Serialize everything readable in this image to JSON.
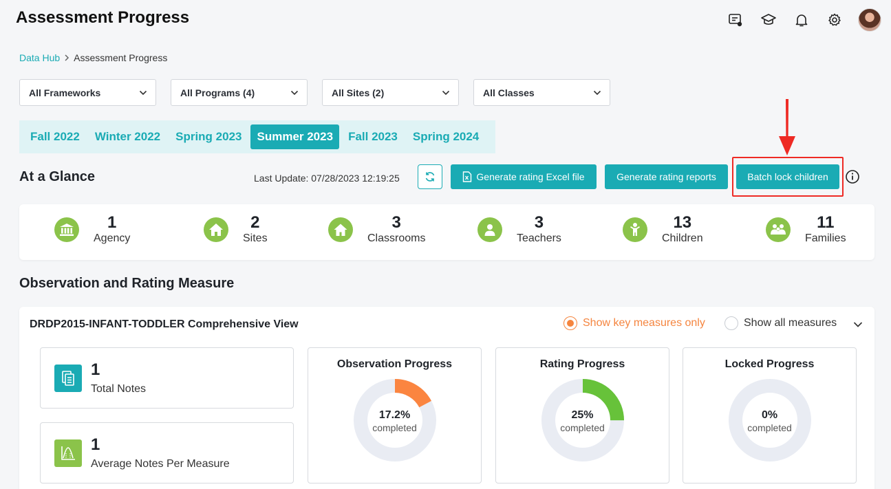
{
  "header": {
    "title": "Assessment Progress",
    "icons": [
      "chat-notice-icon",
      "graduation-cap-icon",
      "bell-icon",
      "gear-icon"
    ]
  },
  "breadcrumb": {
    "parent": "Data Hub",
    "current": "Assessment Progress"
  },
  "filters": {
    "frameworks": "All Frameworks",
    "programs": "All Programs (4)",
    "sites": "All Sites (2)",
    "classes": "All Classes"
  },
  "periods": [
    "Fall 2022",
    "Winter 2022",
    "Spring 2023",
    "Summer 2023",
    "Fall 2023",
    "Spring 2024"
  ],
  "active_period": "Summer 2023",
  "glance": {
    "title": "At a Glance",
    "last_update": "Last Update: 07/28/2023 12:19:25",
    "excel_button": "Generate rating Excel file",
    "reports_button": "Generate rating reports",
    "batch_lock_button": "Batch lock children"
  },
  "stats": [
    {
      "value": "1",
      "label": "Agency",
      "icon": "bank-icon"
    },
    {
      "value": "2",
      "label": "Sites",
      "icon": "house-icon"
    },
    {
      "value": "3",
      "label": "Classrooms",
      "icon": "home-icon"
    },
    {
      "value": "3",
      "label": "Teachers",
      "icon": "person-icon"
    },
    {
      "value": "13",
      "label": "Children",
      "icon": "child-icon"
    },
    {
      "value": "11",
      "label": "Families",
      "icon": "family-icon"
    }
  ],
  "section_title": "Observation and Rating Measure",
  "card": {
    "title": "DRDP2015-INFANT-TODDLER Comprehensive View",
    "key_measures": "Show key measures only",
    "all_measures": "Show all measures",
    "total_notes": {
      "value": "1",
      "label": "Total Notes"
    },
    "avg_notes": {
      "value": "1",
      "label": "Average Notes Per Measure"
    }
  },
  "progress": [
    {
      "title": "Observation Progress",
      "value_text": "17.2%",
      "fraction": 0.172,
      "sub": "completed",
      "color": "#fb8540"
    },
    {
      "title": "Rating Progress",
      "value_text": "25%",
      "fraction": 0.25,
      "sub": "completed",
      "color": "#67c23a"
    },
    {
      "title": "Locked Progress",
      "value_text": "0%",
      "fraction": 0,
      "sub": "completed",
      "color": "#1aabb4"
    }
  ],
  "colors": {
    "accent": "#1aabb4",
    "stat_green": "#8bc34a",
    "highlight": "#ee2a24",
    "ring_bg": "#e9ecf3"
  }
}
